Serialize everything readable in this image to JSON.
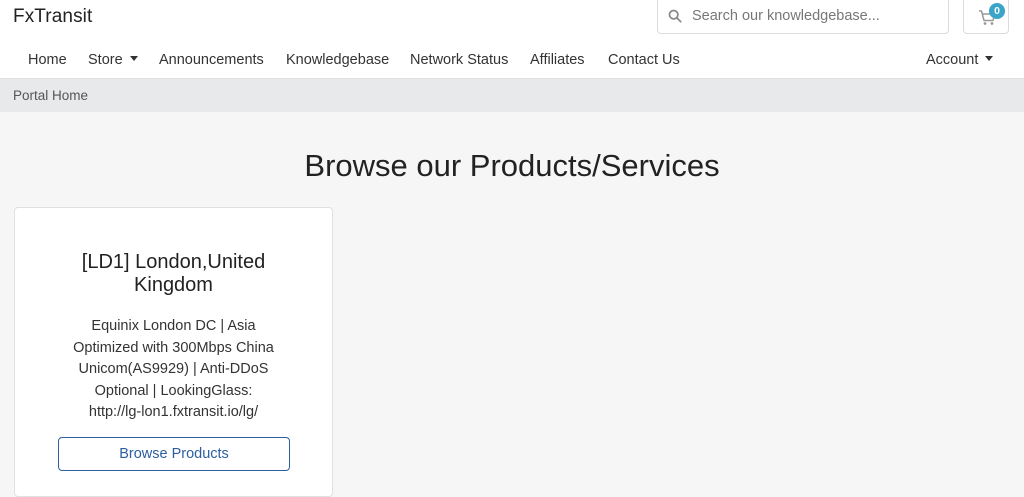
{
  "header": {
    "brand": "FxTransit",
    "search": {
      "placeholder": "Search our knowledgebase...",
      "value": ""
    },
    "cart": {
      "count": "0"
    }
  },
  "nav": {
    "items": [
      {
        "label": "Home"
      },
      {
        "label": "Store"
      },
      {
        "label": "Announcements"
      },
      {
        "label": "Knowledgebase"
      },
      {
        "label": "Network Status"
      },
      {
        "label": "Affiliates"
      },
      {
        "label": "Contact Us"
      }
    ],
    "account": "Account"
  },
  "breadcrumb": {
    "items": [
      {
        "label": "Portal Home"
      }
    ]
  },
  "main": {
    "title": "Browse our Products/Services",
    "products": [
      {
        "title_line1": "[LD1] London,United",
        "title_line2": "Kingdom",
        "description_lines": [
          "Equinix London DC | Asia",
          "Optimized with 300Mbps China",
          "Unicom(AS9929) | Anti-DDoS",
          "Optional | LookingGlass:",
          "http://lg-lon1.fxtransit.io/lg/"
        ],
        "button_label": "Browse Products"
      }
    ]
  },
  "colors": {
    "accent": "#2c5fa0",
    "badge": "#3aa5c9",
    "breadcrumb_bg": "#e8e9ea",
    "page_bg": "#f6f6f6"
  },
  "icons": {
    "search": "search-icon",
    "cart": "cart-icon",
    "dropdown": "caret-down-icon"
  }
}
